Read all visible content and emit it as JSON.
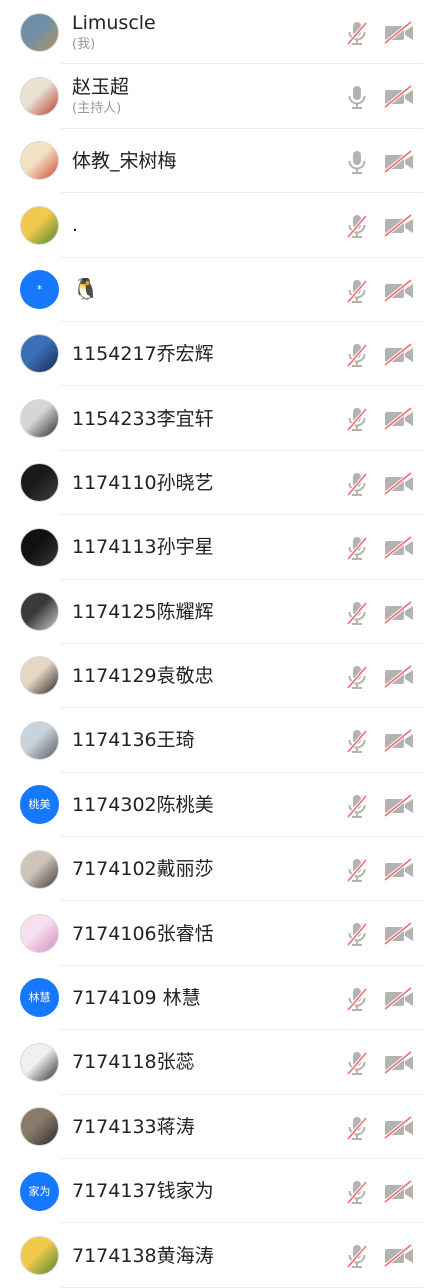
{
  "participants": [
    {
      "name": "Limuscle",
      "sub": "(我)",
      "avatar": {
        "type": "photo",
        "colors": [
          "#6f8fa9",
          "#b4905e"
        ]
      },
      "mic_muted": true,
      "cam_off": true
    },
    {
      "name": "赵玉超",
      "sub": "(主持人)",
      "avatar": {
        "type": "photo",
        "colors": [
          "#e9e2d3",
          "#b63b2e"
        ]
      },
      "mic_muted": false,
      "cam_off": true
    },
    {
      "name": "体教_宋树梅",
      "sub": "",
      "avatar": {
        "type": "photo",
        "colors": [
          "#f3e3c5",
          "#d24a3a"
        ]
      },
      "mic_muted": false,
      "cam_off": true
    },
    {
      "name": ".",
      "sub": "",
      "avatar": {
        "type": "photo",
        "colors": [
          "#f2c94c",
          "#4c8a2f"
        ]
      },
      "mic_muted": true,
      "cam_off": true
    },
    {
      "name": "🐧",
      "sub": "",
      "avatar": {
        "type": "text",
        "text": "*"
      },
      "mic_muted": true,
      "cam_off": true
    },
    {
      "name": "1154217乔宏辉",
      "sub": "",
      "avatar": {
        "type": "photo",
        "colors": [
          "#3b6fb7",
          "#13294f"
        ]
      },
      "mic_muted": true,
      "cam_off": true
    },
    {
      "name": "1154233李宜轩",
      "sub": "",
      "avatar": {
        "type": "photo",
        "colors": [
          "#d6d6d6",
          "#2a2a2a"
        ]
      },
      "mic_muted": true,
      "cam_off": true
    },
    {
      "name": "1174110孙晓艺",
      "sub": "",
      "avatar": {
        "type": "photo",
        "colors": [
          "#1a1a1a",
          "#3f3f3f"
        ]
      },
      "mic_muted": true,
      "cam_off": true
    },
    {
      "name": "1174113孙宇星",
      "sub": "",
      "avatar": {
        "type": "photo",
        "colors": [
          "#111111",
          "#3a3a3a"
        ]
      },
      "mic_muted": true,
      "cam_off": true
    },
    {
      "name": "1174125陈耀辉",
      "sub": "",
      "avatar": {
        "type": "photo",
        "colors": [
          "#3a3a3a",
          "#c9c9c9"
        ]
      },
      "mic_muted": true,
      "cam_off": true
    },
    {
      "name": "1174129袁敬忠",
      "sub": "",
      "avatar": {
        "type": "photo",
        "colors": [
          "#e8d6c4",
          "#2a2a2a"
        ]
      },
      "mic_muted": true,
      "cam_off": true
    },
    {
      "name": "1174136王琦",
      "sub": "",
      "avatar": {
        "type": "photo",
        "colors": [
          "#c9d3dc",
          "#5a5a5a"
        ]
      },
      "mic_muted": true,
      "cam_off": true
    },
    {
      "name": "1174302陈桃美",
      "sub": "",
      "avatar": {
        "type": "text",
        "text": "桃美"
      },
      "mic_muted": true,
      "cam_off": true
    },
    {
      "name": "7174102戴丽莎",
      "sub": "",
      "avatar": {
        "type": "photo",
        "colors": [
          "#cfc4b8",
          "#3d3d3d"
        ]
      },
      "mic_muted": true,
      "cam_off": true
    },
    {
      "name": "7174106张睿恬",
      "sub": "",
      "avatar": {
        "type": "photo",
        "colors": [
          "#f6dff0",
          "#d58ac0"
        ]
      },
      "mic_muted": true,
      "cam_off": true
    },
    {
      "name": "7174109 林慧",
      "sub": "",
      "avatar": {
        "type": "text",
        "text": "林慧"
      },
      "mic_muted": true,
      "cam_off": true
    },
    {
      "name": "7174118张蕊",
      "sub": "",
      "avatar": {
        "type": "photo",
        "colors": [
          "#f0f0f0",
          "#2f2f2f"
        ]
      },
      "mic_muted": true,
      "cam_off": true
    },
    {
      "name": "7174133蒋涛",
      "sub": "",
      "avatar": {
        "type": "photo",
        "colors": [
          "#8a7a6a",
          "#2a2a2a"
        ]
      },
      "mic_muted": true,
      "cam_off": true
    },
    {
      "name": "7174137钱家为",
      "sub": "",
      "avatar": {
        "type": "text",
        "text": "家为"
      },
      "mic_muted": true,
      "cam_off": true
    },
    {
      "name": "7174138黄海涛",
      "sub": "",
      "avatar": {
        "type": "photo",
        "colors": [
          "#f2c94c",
          "#4c8a2f"
        ]
      },
      "mic_muted": true,
      "cam_off": true
    }
  ],
  "colors": {
    "icon_gray": "#b3b3b3",
    "muted_red": "#f26d6d",
    "text_avatar_bg": "#1677ff"
  }
}
